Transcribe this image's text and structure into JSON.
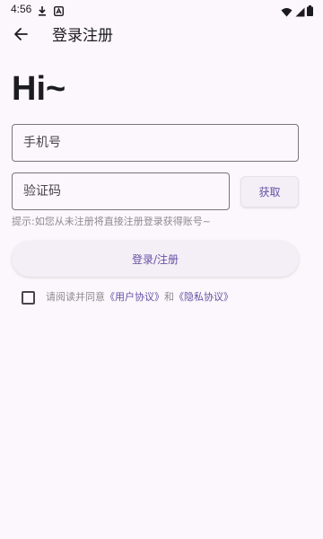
{
  "status_bar": {
    "time": "4:56",
    "icons": [
      "download-icon",
      "app-badge-icon",
      "wifi-icon",
      "signal-icon",
      "battery-icon"
    ]
  },
  "app_bar": {
    "back_icon": "arrow-left-icon",
    "title": "登录注册"
  },
  "greeting": "Hi~",
  "form": {
    "phone_placeholder": "手机号",
    "code_placeholder": "验证码",
    "get_code_label": "获取",
    "hint": "提示:如您从未注册将直接注册登录获得账号~",
    "submit_label": "登录/注册"
  },
  "agreement": {
    "checked": false,
    "prefix": "请阅读并同意",
    "user_agreement": "《用户协议》",
    "conjunction": "和",
    "privacy_policy": "《隐私协议》"
  },
  "colors": {
    "background": "#fcf7fc",
    "accent": "#6750a4",
    "muted_text": "#8d8a91",
    "outline": "#79747e"
  }
}
